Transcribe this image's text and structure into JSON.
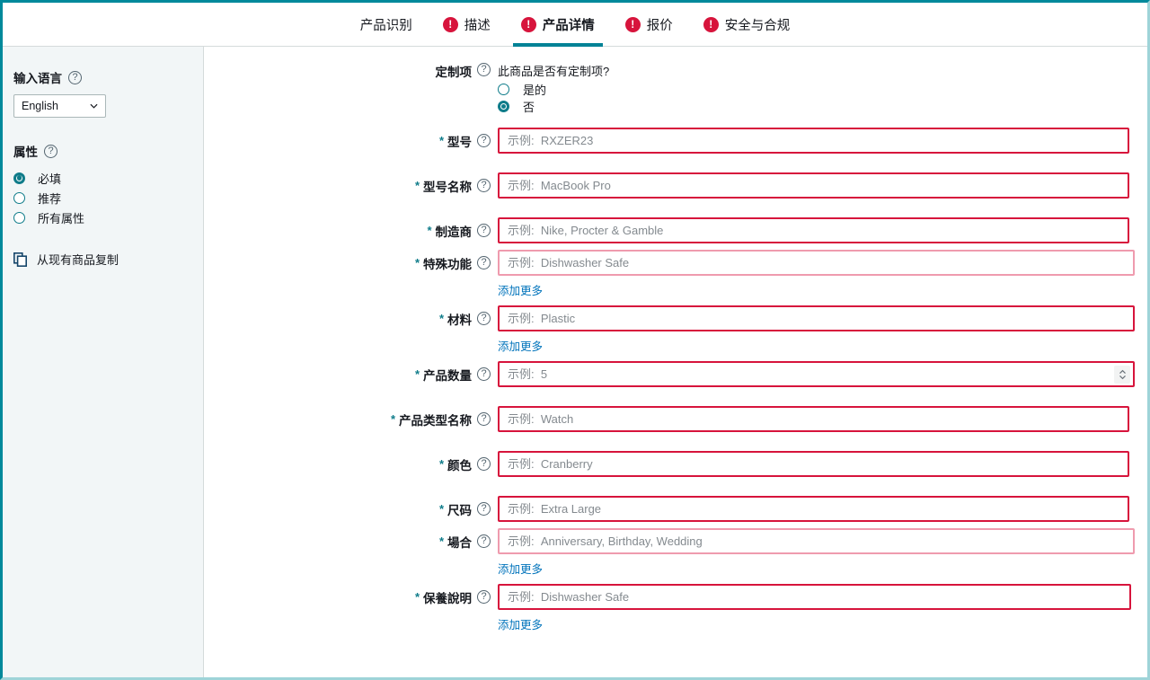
{
  "tabs": [
    {
      "label": "产品识别",
      "has_error": false,
      "active": false
    },
    {
      "label": "描述",
      "has_error": true,
      "active": false
    },
    {
      "label": "产品详情",
      "has_error": true,
      "active": true
    },
    {
      "label": "报价",
      "has_error": true,
      "active": false
    },
    {
      "label": "安全与合规",
      "has_error": true,
      "active": false
    }
  ],
  "error_badge_glyph": "!",
  "sidebar": {
    "language_title": "输入语言",
    "language_value": "English",
    "attributes_title": "属性",
    "attribute_options": [
      {
        "label": "必填",
        "selected": true
      },
      {
        "label": "推荐",
        "selected": false
      },
      {
        "label": "所有属性",
        "selected": false
      }
    ],
    "copy_label": "从现有商品复制",
    "copy_icon": "copy-icon",
    "help_icon": "help-icon",
    "chevron_icon": "chevron-down-icon"
  },
  "form": {
    "customization": {
      "label": "定制项",
      "question": "此商品是否有定制项?",
      "options": [
        {
          "label": "是的",
          "selected": false
        },
        {
          "label": "否",
          "selected": true
        }
      ]
    },
    "fields": [
      {
        "label": "型号",
        "required": true,
        "placeholder": "示例:  RXZER23",
        "width": "w-a",
        "soft": false,
        "add_more": null,
        "stepper": false
      },
      {
        "label": "型号名称",
        "required": true,
        "placeholder": "示例:  MacBook Pro",
        "width": "w-a",
        "soft": false,
        "add_more": null,
        "stepper": false
      },
      {
        "label": "制造商",
        "required": true,
        "placeholder": "示例:  Nike, Procter & Gamble",
        "width": "w-a",
        "soft": false,
        "add_more": null,
        "stepper": false
      },
      {
        "label": "特殊功能",
        "required": true,
        "placeholder": "示例:  Dishwasher Safe",
        "width": "w-b",
        "soft": true,
        "add_more": "添加更多",
        "stepper": false
      },
      {
        "label": "材料",
        "required": true,
        "placeholder": "示例:  Plastic",
        "width": "w-b",
        "soft": false,
        "add_more": "添加更多",
        "stepper": false
      },
      {
        "label": "产品数量",
        "required": true,
        "placeholder": "示例:  5",
        "width": "w-b",
        "soft": false,
        "add_more": null,
        "stepper": true
      },
      {
        "label": "产品类型名称",
        "required": true,
        "placeholder": "示例:  Watch",
        "width": "w-a",
        "soft": false,
        "add_more": null,
        "stepper": false
      },
      {
        "label": "颜色",
        "required": true,
        "placeholder": "示例:  Cranberry",
        "width": "w-a",
        "soft": false,
        "add_more": null,
        "stepper": false
      },
      {
        "label": "尺码",
        "required": true,
        "placeholder": "示例:  Extra Large",
        "width": "w-a",
        "soft": false,
        "add_more": null,
        "stepper": false
      },
      {
        "label": "場合",
        "required": true,
        "placeholder": "示例:  Anniversary, Birthday, Wedding",
        "width": "w-b",
        "soft": true,
        "add_more": "添加更多",
        "stepper": false
      },
      {
        "label": "保養說明",
        "required": true,
        "placeholder": "示例:  Dishwasher Safe",
        "width": "w-c",
        "soft": false,
        "add_more": "添加更多",
        "stepper": false
      }
    ],
    "help_icon": "help-icon",
    "required_marker": "*"
  },
  "colors": {
    "accent_teal": "#008296",
    "error_red": "#d7143c",
    "link_blue": "#0073bb",
    "sidebar_bg": "#f2f6f7",
    "border_gray": "#d5dbdb"
  }
}
